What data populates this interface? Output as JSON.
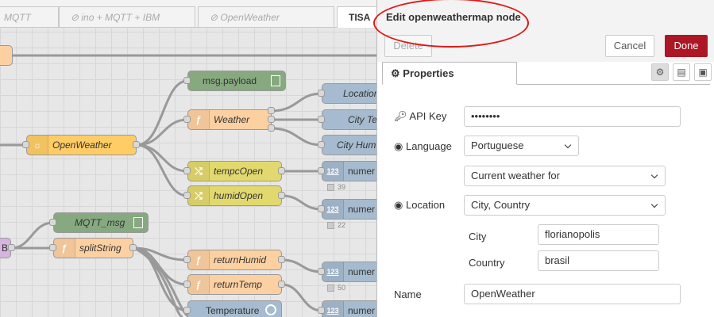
{
  "tabs": [
    "MQTT",
    "ino + MQTT + IBM",
    "OpenWeather",
    "TISA"
  ],
  "nodes": {
    "msg_payload": "msg.payload",
    "weather": "Weather",
    "openweather": "OpenWeather",
    "tempc_open": "tempcOpen",
    "humid_open": "humidOpen",
    "location": "Location",
    "city_temp": "City Te",
    "city_humid": "City Hum",
    "numeric1": "numer",
    "numeric2": "numer",
    "numeric3": "numer",
    "numeric4": "numer",
    "numeric5": "numer",
    "numeric_icon": "123",
    "mqtt_msg": "MQTT_msg",
    "split_string": "splitString",
    "return_humid": "returnHumid",
    "return_temp": "returnTemp",
    "temperature": "Temperature",
    "left_b": "B"
  },
  "status_values": [
    "39",
    "22",
    "50"
  ],
  "tray": {
    "title": "Edit openweathermap node",
    "delete_label": "Delete",
    "cancel_label": "Cancel",
    "done_label": "Done",
    "properties_tab": "Properties"
  },
  "form": {
    "api_key_label": "API Key",
    "api_key_value": "••••••••",
    "language_label": "Language",
    "language_value": "Portuguese",
    "mode_value": "Current weather for",
    "location_label": "Location",
    "location_value": "City, Country",
    "city_label": "City",
    "city_value": "florianopolis",
    "country_label": "Country",
    "country_value": "brasil",
    "name_label": "Name",
    "name_value": "OpenWeather"
  },
  "colors": {
    "done": "#ad1625",
    "function_node": "#fdd0a2",
    "debug_node": "#87a980",
    "change_node": "#e2d96e",
    "ui_node": "#a6bbcf",
    "openweather_node": "#ffcc66",
    "annotation": "#e01919"
  }
}
